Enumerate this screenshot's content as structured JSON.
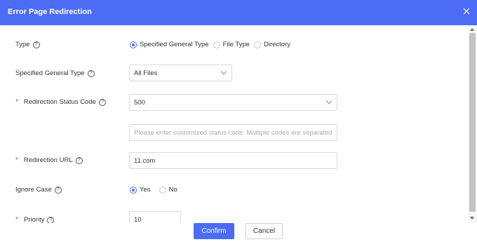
{
  "dialog": {
    "title": "Error Page Redirection"
  },
  "form": {
    "type": {
      "label": "Type",
      "options": [
        "Specified General Type",
        "File Type",
        "Directory"
      ],
      "selected": "Specified General Type"
    },
    "general_type": {
      "label": "Specified General Type",
      "value": "All Files"
    },
    "status_code": {
      "label": "Redirection Status Code",
      "value": "500",
      "custom_placeholder": "Please enter customized status code. Multiple codes are separated"
    },
    "redirect_url": {
      "label": "Redirection URL",
      "value": "11.com"
    },
    "ignore_case": {
      "label": "Ignore Case",
      "options": [
        "Yes",
        "No"
      ],
      "selected": "Yes"
    },
    "priority": {
      "label": "Priority",
      "value": "10"
    }
  },
  "footer": {
    "confirm_label": "Confirm",
    "cancel_label": "Cancel"
  },
  "colors": {
    "accent": "#4c6cf5",
    "required": "#e54545"
  }
}
